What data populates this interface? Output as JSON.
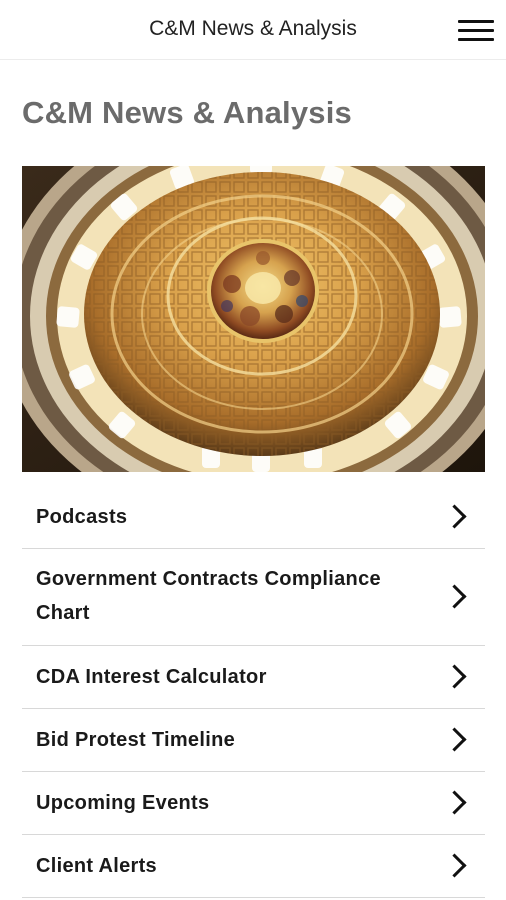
{
  "header": {
    "title": "C&M News & Analysis",
    "menu_icon": "hamburger-menu-icon"
  },
  "page": {
    "title": "C&M News & Analysis"
  },
  "hero": {
    "subject": "capitol-dome-interior-image"
  },
  "menu": {
    "items": [
      {
        "label": "Podcasts",
        "icon": "chevron-right-icon"
      },
      {
        "label": "Government Contracts Compliance Chart",
        "icon": "chevron-right-icon"
      },
      {
        "label": "CDA Interest Calculator",
        "icon": "chevron-right-icon"
      },
      {
        "label": "Bid Protest Timeline",
        "icon": "chevron-right-icon"
      },
      {
        "label": "Upcoming Events",
        "icon": "chevron-right-icon"
      },
      {
        "label": "Client Alerts",
        "icon": "chevron-right-icon"
      }
    ]
  },
  "colors": {
    "title_gray": "#6b6b6b",
    "text_dark": "#1a1a1a",
    "divider": "#d8d8d8",
    "dome_gold": "#d4a24a"
  }
}
